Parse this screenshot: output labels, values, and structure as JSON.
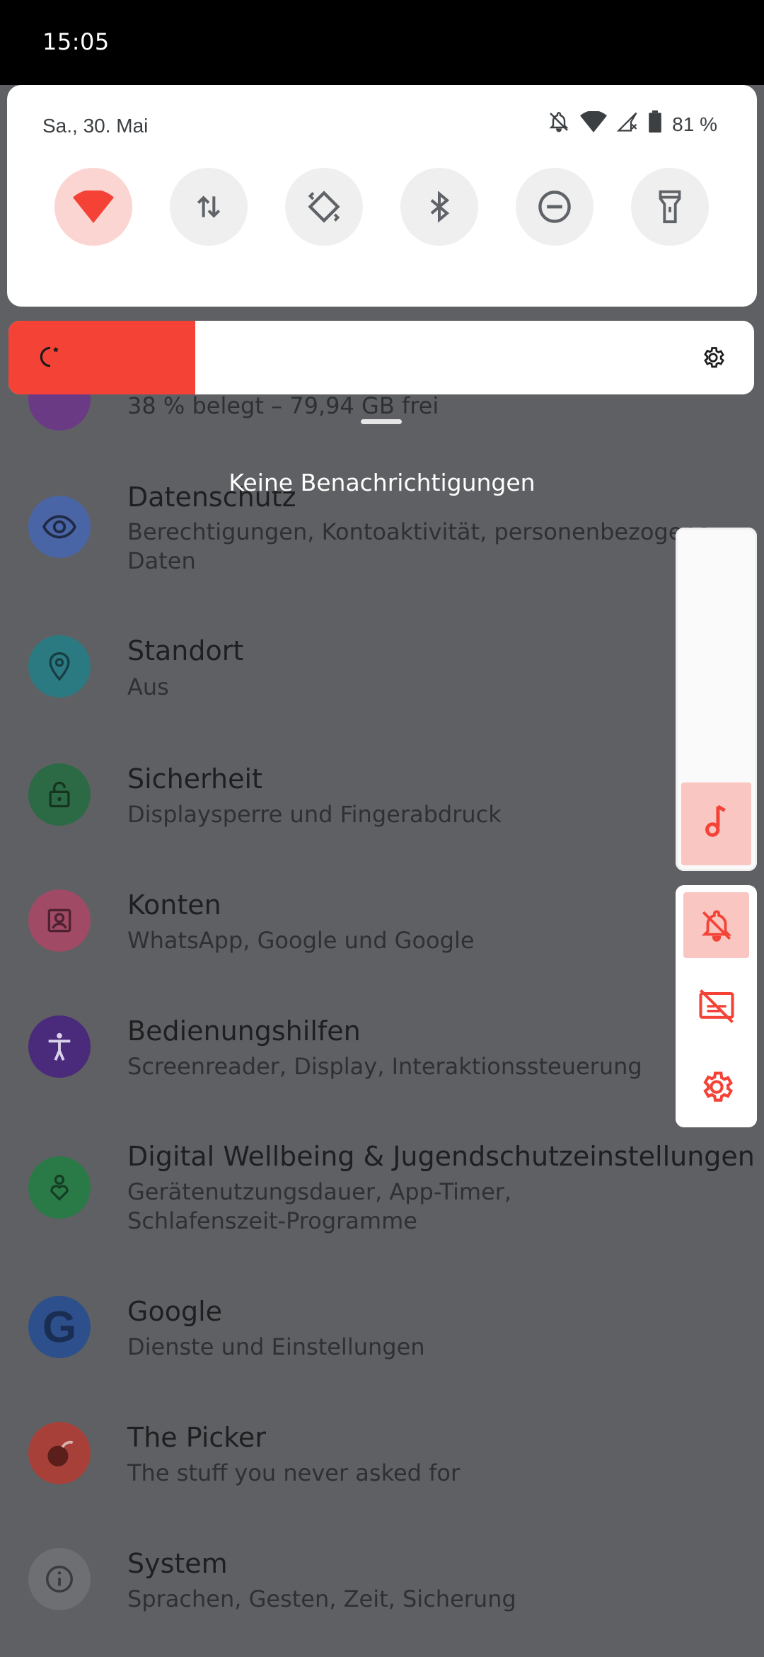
{
  "status_bar": {
    "time": "15:05"
  },
  "quick_settings": {
    "date": "Sa., 30. Mai",
    "battery_text": "81 %",
    "accent_color": "#f44336",
    "tiles": [
      {
        "name": "wifi",
        "icon": "wifi-icon",
        "active": true
      },
      {
        "name": "mobile-data",
        "icon": "data-transfer-icon",
        "active": false
      },
      {
        "name": "auto-rotate",
        "icon": "auto-rotate-icon",
        "active": false
      },
      {
        "name": "bluetooth",
        "icon": "bluetooth-icon",
        "active": false
      },
      {
        "name": "do-not-disturb",
        "icon": "do-not-disturb-icon",
        "active": false
      },
      {
        "name": "flashlight",
        "icon": "flashlight-icon",
        "active": false
      }
    ]
  },
  "brightness": {
    "level_fraction": 0.25
  },
  "notifications": {
    "empty_text": "Keine Benachrichtigungen"
  },
  "settings": {
    "storage_subtitle": "38 % belegt – 79,94 GB frei",
    "items": [
      {
        "title": "Datenschutz",
        "subtitle": "Berechtigungen, Kontoaktivität, personenbezogene Daten",
        "icon": "privacy-eye-icon",
        "color": "#4a65a6"
      },
      {
        "title": "Standort",
        "subtitle": "Aus",
        "icon": "location-pin-icon",
        "color": "#2b7a82"
      },
      {
        "title": "Sicherheit",
        "subtitle": "Displaysperre und Fingerabdruck",
        "icon": "unlock-icon",
        "color": "#2c6a45"
      },
      {
        "title": "Konten",
        "subtitle": "WhatsApp, Google und Google",
        "icon": "account-box-icon",
        "color": "#a04a66"
      },
      {
        "title": "Bedienungshilfen",
        "subtitle": "Screenreader, Display, Interaktionssteuerung",
        "icon": "accessibility-icon",
        "color": "#4a2a7a"
      },
      {
        "title": "Digital Wellbeing & Jugendschutzeinstellungen",
        "subtitle": "Gerätenutzungsdauer, App-Timer, Schlafenszeit-Programme",
        "icon": "wellbeing-icon",
        "color": "#2a7a48"
      },
      {
        "title": "Google",
        "subtitle": "Dienste und Einstellungen",
        "icon": "google-icon",
        "color": "#2d4f8c"
      },
      {
        "title": "The Picker",
        "subtitle": "The stuff you never asked for",
        "icon": "picker-icon",
        "color": "#a8403a"
      },
      {
        "title": "System",
        "subtitle": "Sprachen, Gesten, Zeit, Sicherung",
        "icon": "info-icon",
        "color": "#6e6f72"
      }
    ]
  },
  "volume": {
    "level_fraction": 0.25,
    "stream_icon": "music-note-icon",
    "actions": [
      {
        "name": "ringer-mute",
        "icon": "bell-off-icon",
        "active": true
      },
      {
        "name": "live-caption",
        "icon": "caption-off-icon",
        "active": false
      },
      {
        "name": "sound-settings",
        "icon": "settings-gear-icon",
        "active": false
      }
    ]
  }
}
